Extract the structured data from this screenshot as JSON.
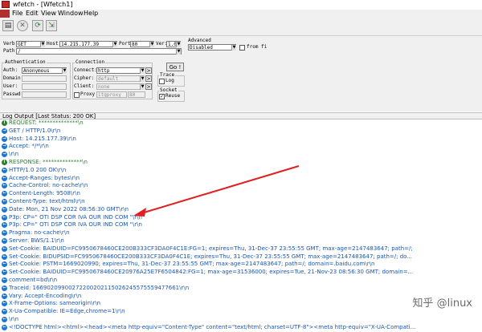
{
  "window": {
    "title": "wfetch - [Wfetch1]"
  },
  "menu": [
    "File",
    "Edit",
    "View",
    "Window",
    "Help"
  ],
  "toolbar": {
    "buttons": [
      "new-request",
      "stop",
      "refresh",
      "export"
    ]
  },
  "request": {
    "verb_label": "Verb:",
    "verb_value": "GET",
    "host_label": "Host:",
    "host_value": "14.215.177.39",
    "port_label": "Port:",
    "port_value": "80",
    "ver_label": "Ver:",
    "ver_value": "1.0",
    "path_label": "Path:",
    "path_value": "/"
  },
  "advanced": {
    "label": "Advanced",
    "value": "Disabled",
    "from_file_label": "from fi"
  },
  "auth": {
    "group_label": "Authentication",
    "auth_label": "Auth:",
    "auth_value": "Anonymous",
    "domain_label": "Domain:",
    "user_label": "User:",
    "passwd_label": "Passwd:"
  },
  "connection": {
    "group_label": "Connection",
    "connect_label": "Connect:",
    "connect_value": "http",
    "cipher_label": "Cipher:",
    "cipher_value": "default",
    "client_label": "Client:",
    "client_value": "none",
    "proxy_label": "Proxy",
    "proxy_value": "itgproxy",
    "proxy_port": "80"
  },
  "go_button": "Go !",
  "trace": {
    "label": "Trace",
    "log_label": "Log"
  },
  "socket": {
    "label": "Socket",
    "reuse_label": "Reuse",
    "reuse_checked": "✓"
  },
  "log_header": "Log Output [Last Status: 200 OK]",
  "log_lines": [
    {
      "icon": "i",
      "green": true,
      "text": "REQUEST: **************\\n"
    },
    {
      "icon": "→",
      "green": false,
      "text": "GET / HTTP/1.0\\r\\n"
    },
    {
      "icon": "→",
      "green": false,
      "text": "Host: 14.215.177.39\\r\\n"
    },
    {
      "icon": "→",
      "green": false,
      "text": "Accept: */*\\r\\n"
    },
    {
      "icon": "→",
      "green": false,
      "text": "\\r\\n"
    },
    {
      "icon": "i",
      "green": true,
      "text": "RESPONSE: **************\\n"
    },
    {
      "icon": "←",
      "green": false,
      "text": "HTTP/1.0 200 OK\\r\\n"
    },
    {
      "icon": "←",
      "green": false,
      "text": "Accept-Ranges: bytes\\r\\n"
    },
    {
      "icon": "←",
      "green": false,
      "text": "Cache-Control: no-cache\\r\\n"
    },
    {
      "icon": "←",
      "green": false,
      "text": "Content-Length: 9508\\r\\n"
    },
    {
      "icon": "←",
      "green": false,
      "text": "Content-Type: text/html\\r\\n"
    },
    {
      "icon": "←",
      "green": false,
      "text": "Date: Mon, 21 Nov 2022 08:56:30 GMT\\r\\n"
    },
    {
      "icon": "←",
      "green": false,
      "text": "P3p: CP=\" OTI DSP COR IVA OUR IND COM \"\\r\\n"
    },
    {
      "icon": "←",
      "green": false,
      "text": "P3p: CP=\" OTI DSP COR IVA OUR IND COM \"\\r\\n"
    },
    {
      "icon": "←",
      "green": false,
      "text": "Pragma: no-cache\\r\\n"
    },
    {
      "icon": "←",
      "green": false,
      "text": "Server: BWS/1.1\\r\\n"
    },
    {
      "icon": "←",
      "green": false,
      "text": "Set-Cookie: BAIDUID=FC9950678460CE200B333CF3DA0F4C1E:FG=1; expires=Thu, 31-Dec-37 23:55:55 GMT; max-age=2147483647; path=/;"
    },
    {
      "icon": "←",
      "green": false,
      "text": "Set-Cookie: BIDUPSID=FC9950678460CE200B333CF3DA0F4C1E; expires=Thu, 31-Dec-37 23:55:55 GMT; max-age=2147483647; path=/; do..."
    },
    {
      "icon": "←",
      "green": false,
      "text": "Set-Cookie: PSTM=1669020990; expires=Thu, 31-Dec-37 23:55:55 GMT; max-age=2147483647; path=/; domain=.baidu.com\\r\\n"
    },
    {
      "icon": "←",
      "green": false,
      "text": "Set-Cookie: BAIDUID=FC9950678460CE20976A25E7F6504842:FG=1; max-age=31536000; expires=Tue, 21-Nov-23 08:56:30 GMT; domain=..."
    },
    {
      "icon": "←",
      "green": false,
      "text": "comment=bd\\r\\n"
    },
    {
      "icon": "←",
      "green": false,
      "text": "Traceid: 16690209900272200202115026245575559477661\\r\\n"
    },
    {
      "icon": "←",
      "green": false,
      "text": "Vary: Accept-Encoding\\r\\n"
    },
    {
      "icon": "←",
      "green": false,
      "text": "X-Frame-Options: sameorigin\\r\\n"
    },
    {
      "icon": "←",
      "green": false,
      "text": "X-Ua-Compatible: IE=Edge,chrome=1\\r\\n"
    },
    {
      "icon": "←",
      "green": false,
      "text": "\\r\\n"
    },
    {
      "icon": "←",
      "green": false,
      "text": "<!DOCTYPE html><html><head><meta http-equiv=\"Content-Type\" content=\"text/html; charset=UTF-8\"><meta http-equiv=\"X-UA-Compati..."
    }
  ],
  "annotation": {
    "color": "#e02020"
  },
  "watermark": "知乎 @linux"
}
